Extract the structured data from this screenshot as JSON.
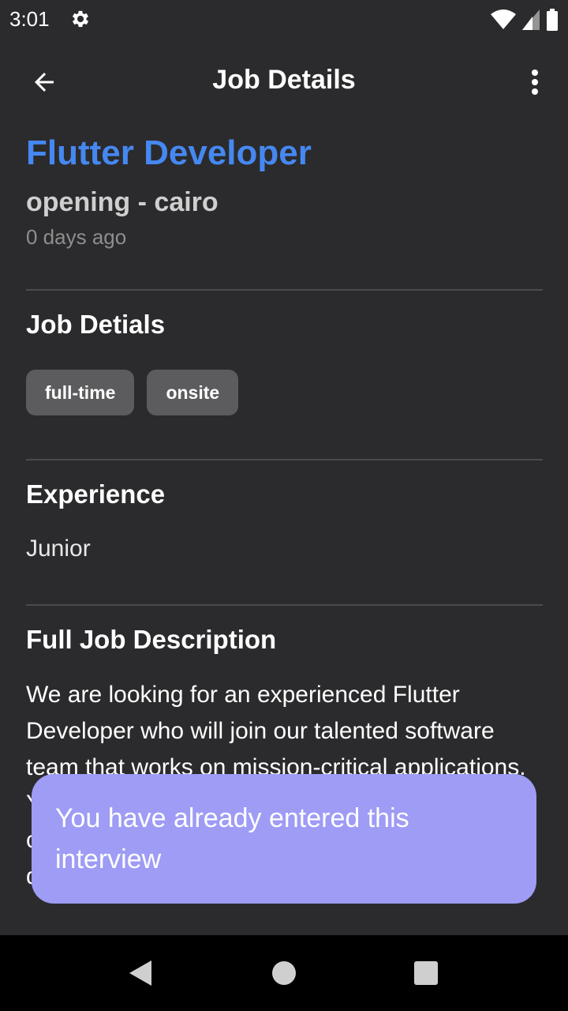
{
  "status_bar": {
    "time": "3:01"
  },
  "app_bar": {
    "title": "Job Details"
  },
  "job": {
    "title": "Flutter Developer",
    "subtitle": "opening - cairo",
    "posted": "0 days ago"
  },
  "details": {
    "heading": "Job Detials",
    "chips": [
      "full-time",
      "onsite"
    ]
  },
  "experience": {
    "heading": "Experience",
    "value": "Junior"
  },
  "description": {
    "heading": "Full Job Description",
    "text": "We are looking for an experienced Flutter Developer who will join our talented software team that works on mission-critical applications. You will be in charge of all aspects from design, code and expertise in the full software development life cycle from concept and"
  },
  "toast": {
    "message": "You have already entered this interview"
  },
  "colors": {
    "accent": "#4688f1",
    "background": "#2b2b2d",
    "toast": "#9e9cf5"
  },
  "icons": [
    "settings-icon",
    "wifi-icon",
    "signal-icon",
    "battery-icon",
    "back-arrow-icon",
    "more-vert-icon",
    "nav-back-icon",
    "nav-home-icon",
    "nav-recents-icon"
  ]
}
